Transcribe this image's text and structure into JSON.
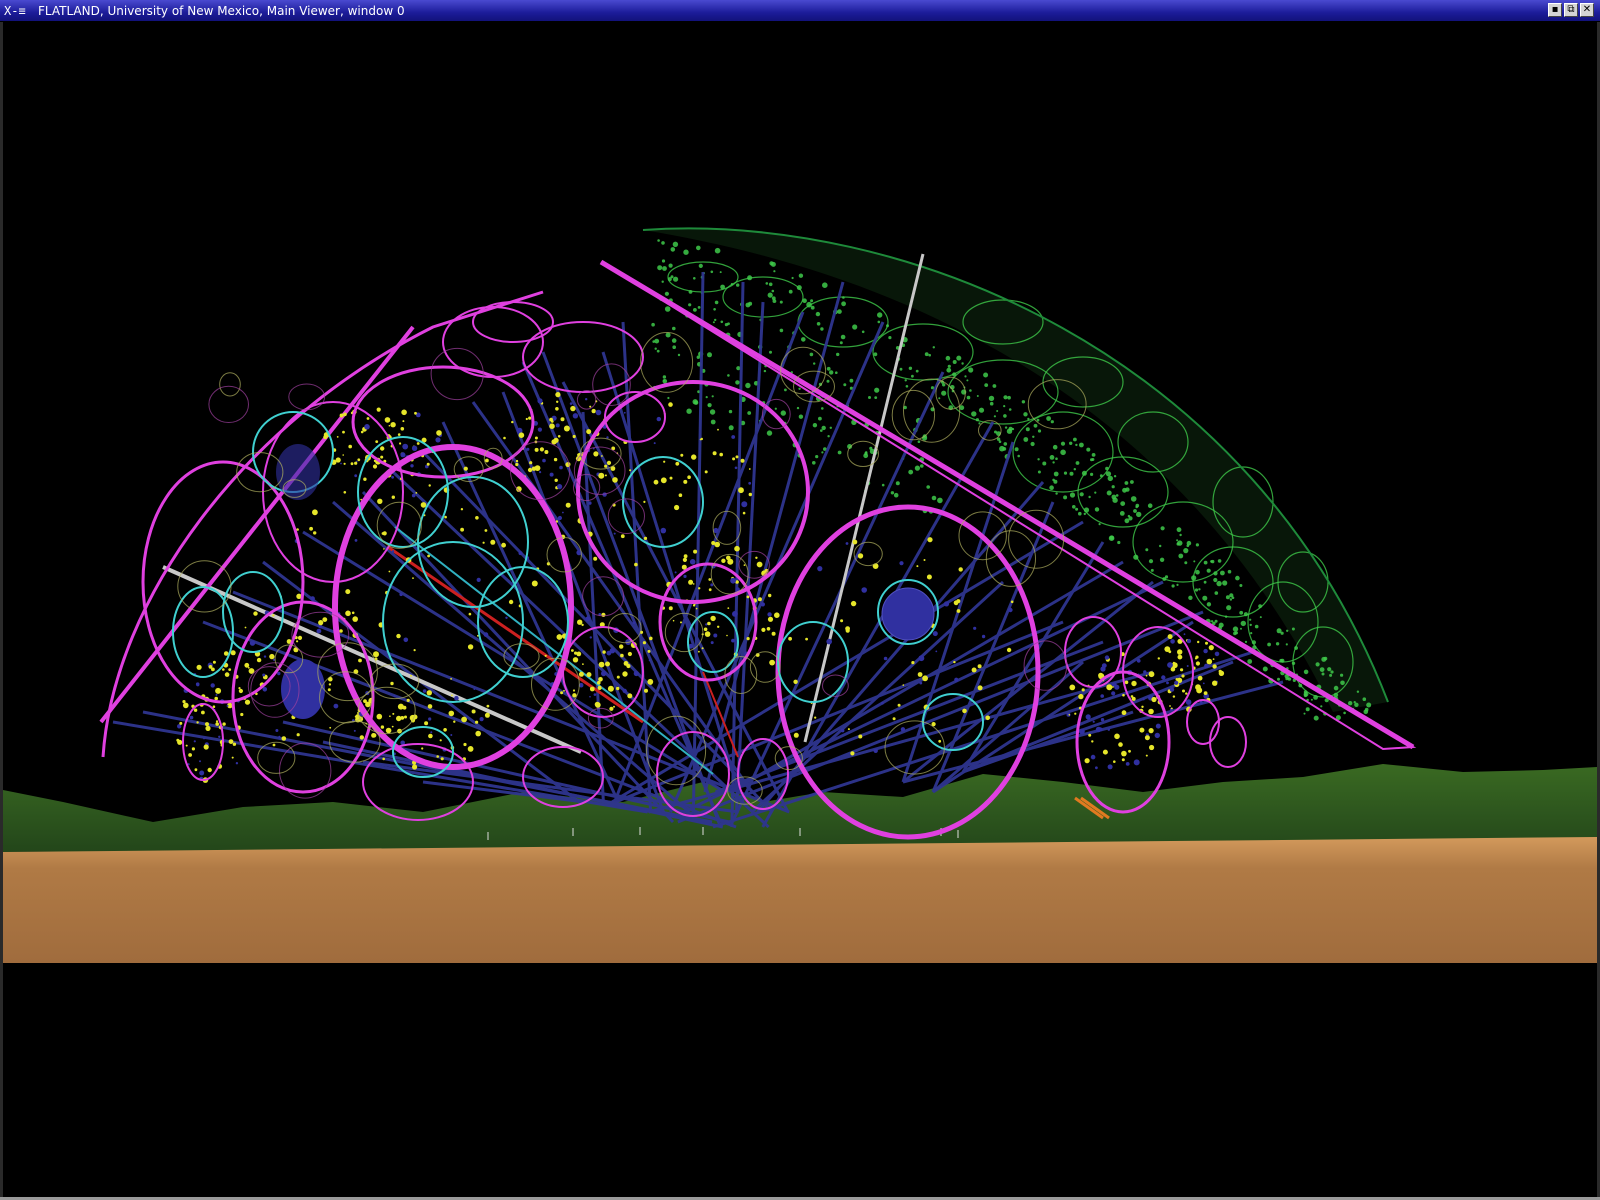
{
  "window": {
    "title": "FLATLAND, University of New Mexico, Main Viewer, window 0",
    "menu_icon": "X-≡",
    "controls": {
      "minimize": "▪",
      "restore": "⧉",
      "close": "✕"
    }
  },
  "scene": {
    "sky_color": "#000000",
    "hills_color": "#2f5a1a",
    "floor_color": "#b07a45",
    "dome_right_color": "#3ec94a",
    "ring_color": "#e040e0",
    "inner_ring_color": "#40d0d0",
    "link_color": "#2a2f8a",
    "dot_color": "#e6e62a",
    "node_color": "#3030a0"
  }
}
